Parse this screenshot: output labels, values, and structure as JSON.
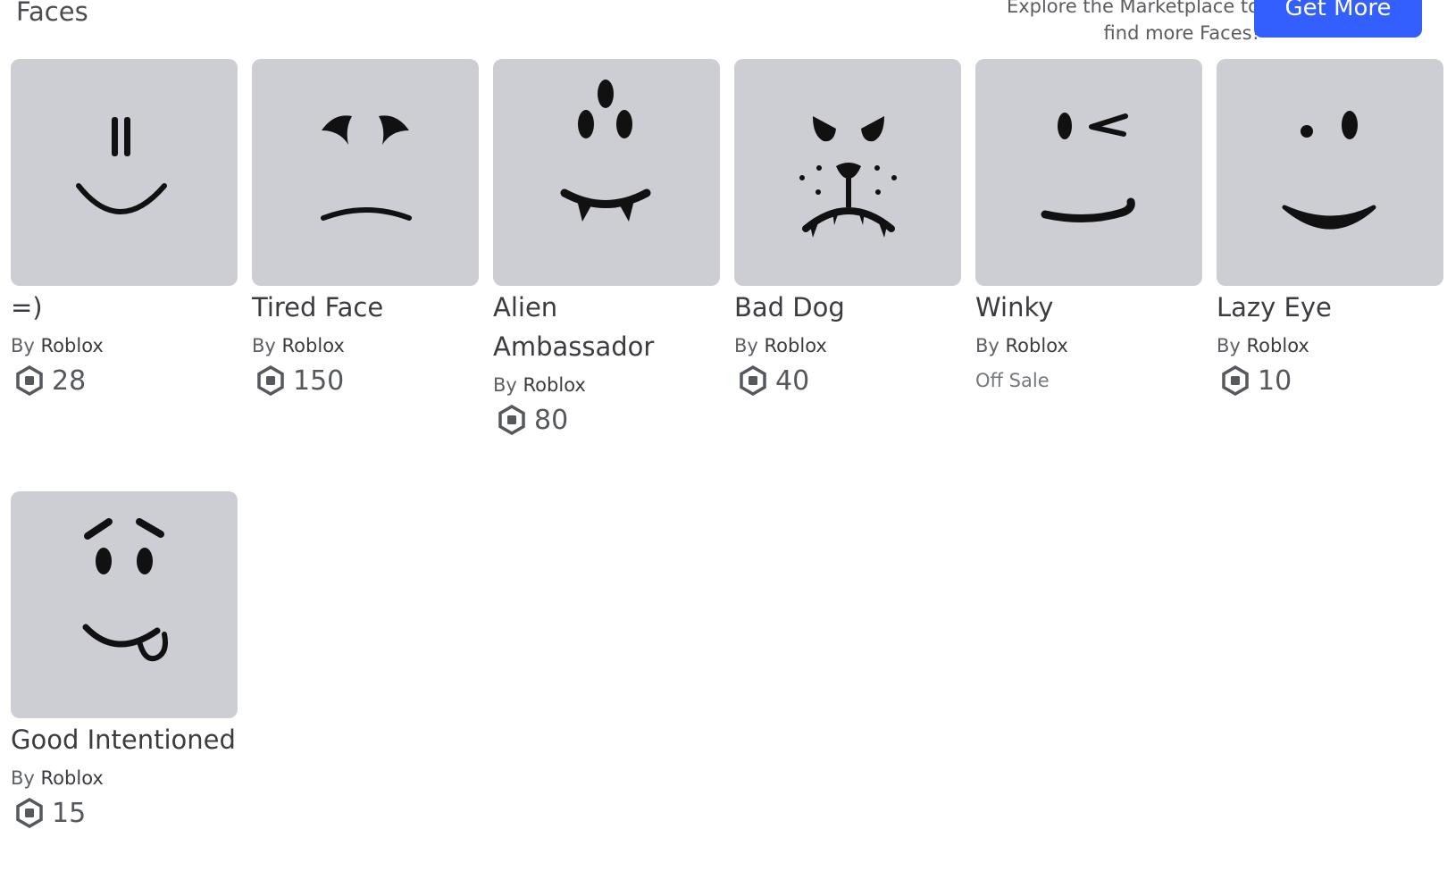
{
  "header": {
    "title": "Faces",
    "subtitle_top": "Explore the Marketplace to",
    "subtitle_bottom": "find more Faces!",
    "button_label": "Get More"
  },
  "items": [
    {
      "name": "=)",
      "by": "By",
      "creator": "Roblox",
      "price": "28",
      "face": "equals-smile-face"
    },
    {
      "name": "Tired Face",
      "by": "By",
      "creator": "Roblox",
      "price": "150",
      "face": "tired-face"
    },
    {
      "name": "Alien Ambassador",
      "by": "By",
      "creator": "Roblox",
      "price": "80",
      "face": "alien-ambassador-face"
    },
    {
      "name": "Bad Dog",
      "by": "By",
      "creator": "Roblox",
      "price": "40",
      "face": "bad-dog-face"
    },
    {
      "name": "Winky",
      "by": "By",
      "creator": "Roblox",
      "status": "Off Sale",
      "face": "winky-face"
    },
    {
      "name": "Lazy Eye",
      "by": "By",
      "creator": "Roblox",
      "price": "10",
      "face": "lazy-eye-face"
    },
    {
      "name": "Good Intentioned",
      "by": "By",
      "creator": "Roblox",
      "price": "15",
      "face": "good-intentioned-face"
    }
  ],
  "icons": {
    "currency": "robux-icon"
  },
  "colors": {
    "accent": "#335fff",
    "thumb_bg": "#cdced3",
    "text": "#3a3c3f"
  }
}
